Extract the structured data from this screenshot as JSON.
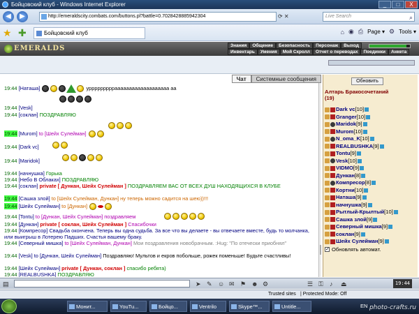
{
  "window": {
    "title": "Бойцовский клуб - Windows Internet Explorer",
    "buttons": [
      "_",
      "□",
      "X"
    ]
  },
  "browser": {
    "back": "◀",
    "forward": "▶",
    "url": "http://emeraldscity.combats.com/buttons.pl?battle=0.7028428885942304",
    "search_placeholder": "Live Search",
    "tab_title": "Бойцовский клуб",
    "page_menu": "Page ▾",
    "tools_menu": "Tools ▾"
  },
  "game": {
    "logo": "EMERALDS",
    "menu_top": [
      "Знания",
      "Общение",
      "Безопасность",
      "Персонаж",
      "Выход"
    ],
    "menu_bottom": [
      "Инвентарь",
      "Умения",
      "Мой Скролл",
      "Отчет о переводах",
      "Поединки",
      "Анкета"
    ]
  },
  "chat": {
    "tabs": [
      "Чат",
      "Системные сообщения"
    ],
    "lines": [
      {
        "time": "19:44",
        "nick": "[Наташа]",
        "text": " урррррррррааааааааааааааааааа аа"
      },
      {
        "time": "19:44",
        "nick": "[Vesk]",
        "text": ""
      },
      {
        "time": "19:44",
        "nick": "[соклан]",
        "text": " ПОЗДРАВЛЯЮ"
      },
      {
        "time": "19:44",
        "nick": "[Murom]",
        "to": " to [Шейх Сулейман]",
        "text": ""
      },
      {
        "time": "19:44",
        "nick": "[Dark vc]",
        "text": ""
      },
      {
        "time": "19:44",
        "nick": "[Maridok]",
        "text": ""
      },
      {
        "time": "19:44",
        "nick": "[начнушка]",
        "text": " Горька"
      },
      {
        "time": "19:44",
        "nick": "[Небо В Облаках]",
        "text": " ПОЗДРАВЛЯЮ"
      },
      {
        "time": "19:44",
        "nick": "[соклан]",
        "private": " private [ Дункан, Шейх Сулейман ]",
        "text": " ПОЗДРАВЛЯЕМ ВАС ОТ ВСЕХ ДУШ НАХОДЯЩИХСЯ В КЛУБЕ"
      },
      {
        "time": "19:44",
        "nick": "[Сашка злой]",
        "to": " to [Шейх Сулейман, Дункан]",
        "text": " ну теперь можно садится на шею))!!!"
      },
      {
        "time": "19:44",
        "nick": "[Шейх Сулейман]",
        "to": " to [Дункан]",
        "text": ""
      },
      {
        "time": "19:44",
        "nick": "[Tontu]",
        "to": " to [Дункан, Шейх Сулейман]",
        "text": " поздравляем"
      },
      {
        "time": "19:44",
        "nick": "[Дункан]",
        "private": " private [ соклан, Шейх Сулейман ]",
        "text": " Спасибочки"
      },
      {
        "time": "19:44",
        "nick": "[Компресор]",
        "text": " Свадьба окончена. Теперь вы одна судьба. За все что вы делаете - вы отвечаете вместе, будь то молчанка, или выигрыш в Лотерею Падших. Счастья вашему браку."
      },
      {
        "time": "19:44",
        "nick": "[Северный мишка]",
        "to": " to [Шейх Сулейман, Дункан]",
        "text": " Мои поздравления новобрачным. :Hug: \"По отечески приобнял\""
      },
      {
        "time": "19:44",
        "nick": "[Vesk]",
        "to": " to [Дункан, Шейх Сулейман]",
        "text": " Поздравляю! Мультов и екров побольше, рожек поменьше! Будьте счастливы!"
      },
      {
        "time": "19:44",
        "nick": "[Шейх Сулейман]",
        "private": " private [ Дункан, соклан ]",
        "text": " спасибо ребята)"
      },
      {
        "time": "19:44",
        "nick": "[REALBUSHKA]",
        "text": " ПОЗДРАВЛЯЮ"
      }
    ]
  },
  "side": {
    "refresh": "Обновить",
    "room": "Алтарь Бракосочетаний",
    "count": "(19)",
    "users": [
      {
        "name": "Dark vc",
        "level": "[10]"
      },
      {
        "name": "Granger",
        "level": "[10]"
      },
      {
        "name": "Maridok",
        "level": "[9]"
      },
      {
        "name": "Murom",
        "level": "[10]"
      },
      {
        "name": "N_oma_K",
        "level": "[10]"
      },
      {
        "name": "REALBUSHKA",
        "level": "[9]"
      },
      {
        "name": "Tontu",
        "level": "[9]"
      },
      {
        "name": "Vesk",
        "level": "[10]"
      },
      {
        "name": "VIDMO",
        "level": "[9]"
      },
      {
        "name": "Дункан",
        "level": "[8]"
      },
      {
        "name": "Компресор",
        "level": "[8]"
      },
      {
        "name": "Кортни",
        "level": "[10]"
      },
      {
        "name": "Наташа",
        "level": "[9]"
      },
      {
        "name": "начнушка",
        "level": "[9]"
      },
      {
        "name": "Рытлый-Крылтый",
        "level": "[10]"
      },
      {
        "name": "Сашка злой",
        "level": "[9]"
      },
      {
        "name": "Северный мишка",
        "level": "[9]"
      },
      {
        "name": "соклан",
        "level": "[9]"
      },
      {
        "name": "Шейх Сулейман",
        "level": "[9]"
      }
    ],
    "auto_label": "Обновлять автомат."
  },
  "statusbar": {
    "trusted": "Trusted sites",
    "protected": "| Protected Mode: Off"
  },
  "taskbar": {
    "tasks": [
      "Монит...",
      "YouTu...",
      "Бойцо...",
      "Ventrilo",
      "Skype™...",
      "Untitle..."
    ],
    "lang": "EN",
    "watermark": "photo-crafts.ru"
  },
  "colors": {
    "nick": "#000080",
    "time": "#006600",
    "private": "#d00000",
    "to": "#cc6600",
    "room": "#800000"
  }
}
